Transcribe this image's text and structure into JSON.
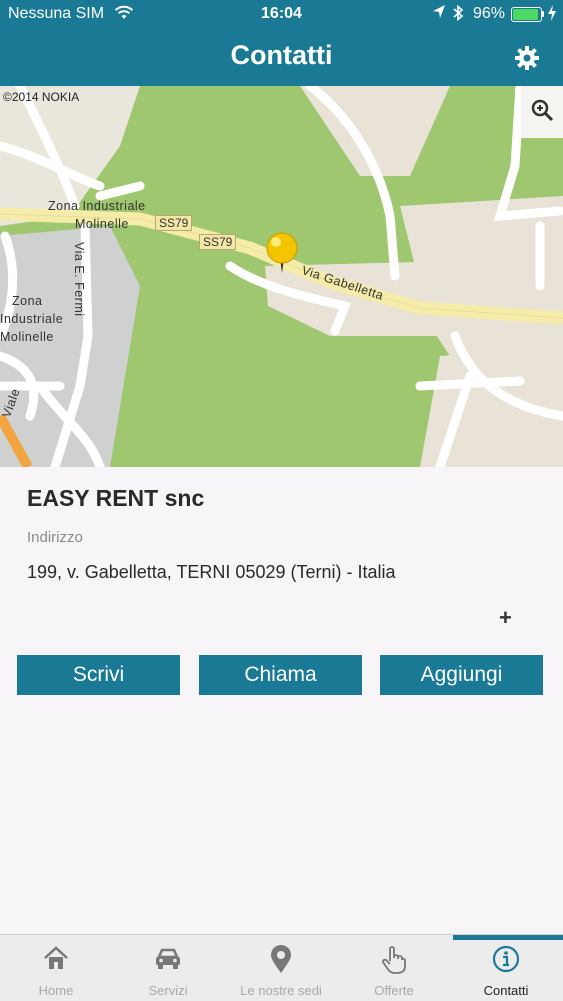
{
  "status_bar": {
    "carrier": "Nessuna SIM",
    "time": "16:04",
    "battery_percent": "96%",
    "battery_level": 0.96,
    "icons": [
      "wifi-icon",
      "location-arrow-icon",
      "bluetooth-icon",
      "battery-icon",
      "charging-icon"
    ]
  },
  "nav": {
    "title": "Contatti",
    "settings_icon": "gear-icon"
  },
  "map": {
    "copyright": "©2014 NOKIA",
    "zoom_icon": "magnifier-zoom-icon",
    "labels": {
      "zona_top_1": "Zona Industriale",
      "zona_top_2": "Molinelle",
      "zona_left_1": "Zona",
      "zona_left_2": "Industriale",
      "zona_left_3": "Molinelle",
      "via_fermi": "Via E. Fermi",
      "via_gabelletta": "Via Gabelletta",
      "ss79_a": "SS79",
      "ss79_b": "SS79",
      "via_edge": "Viale"
    },
    "pin_icon": "map-pin-icon"
  },
  "contact": {
    "name": "EASY RENT snc",
    "address_label": "Indirizzo",
    "address": "199, v. Gabelletta, TERNI 05029 (Terni) - Italia",
    "expand_label": "+"
  },
  "actions": {
    "write": "Scrivi",
    "call": "Chiama",
    "add": "Aggiungi"
  },
  "tabs": [
    {
      "label": "Home",
      "icon": "home-icon",
      "active": false
    },
    {
      "label": "Servizi",
      "icon": "car-icon",
      "active": false
    },
    {
      "label": "Le nostre sedi",
      "icon": "location-pin-icon",
      "active": false
    },
    {
      "label": "Offerte",
      "icon": "hand-pointer-icon",
      "active": false
    },
    {
      "label": "Contatti",
      "icon": "info-icon",
      "active": true
    }
  ],
  "colors": {
    "accent": "#1a7a96",
    "map_green": "#9ec76f",
    "road_yellow": "#f6ecaa",
    "pin_yellow": "#f5c400"
  }
}
